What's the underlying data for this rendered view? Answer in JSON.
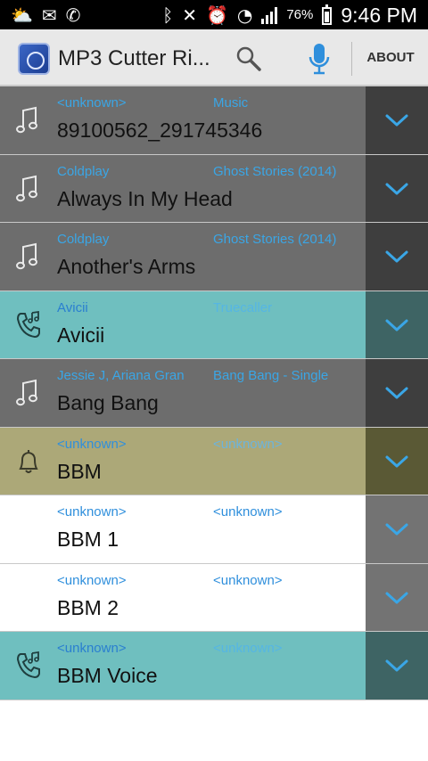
{
  "status_bar": {
    "left_icons": [
      "weather-icon",
      "message-icon",
      "missed-call-icon"
    ],
    "right_icons": [
      "bluetooth-icon",
      "vibrate-icon",
      "alarm-icon",
      "wifi-icon",
      "signal-icon"
    ],
    "battery_percent_text": "76%",
    "battery_level": 0.76,
    "time": "9:46 PM"
  },
  "app_bar": {
    "title": "MP3 Cutter Ri...",
    "about_label": "ABOUT",
    "accent_color": "#2f8fdc"
  },
  "rows": [
    {
      "type": "music",
      "artist": "<unknown>",
      "album": "Music",
      "title": "89100562_291745346",
      "bg": "#6d6d6d",
      "expand_bg": "#3e3e3e",
      "artist_color": "#3aa6e6",
      "album_color": "#3aa6e6",
      "title_color": "#111111"
    },
    {
      "type": "music",
      "artist": "Coldplay",
      "album": "Ghost Stories (2014)",
      "title": "Always In My Head",
      "bg": "#6d6d6d",
      "expand_bg": "#3e3e3e",
      "artist_color": "#3aa6e6",
      "album_color": "#3aa6e6",
      "title_color": "#111111"
    },
    {
      "type": "music",
      "artist": "Coldplay",
      "album": "Ghost Stories (2014)",
      "title": "Another's Arms",
      "bg": "#6d6d6d",
      "expand_bg": "#3e3e3e",
      "artist_color": "#3aa6e6",
      "album_color": "#3aa6e6",
      "title_color": "#111111"
    },
    {
      "type": "ringtone",
      "artist": "Avicii",
      "album": "Truecaller",
      "title": "Avicii",
      "bg": "#6fbfbf",
      "expand_bg": "#3e6464",
      "artist_color": "#2a7fd0",
      "album_color": "#55b6e4",
      "title_color": "#111111"
    },
    {
      "type": "music",
      "artist": "Jessie J, Ariana Gran",
      "album": "Bang Bang - Single",
      "title": "Bang Bang",
      "bg": "#6d6d6d",
      "expand_bg": "#3e3e3e",
      "artist_color": "#3aa6e6",
      "album_color": "#3aa6e6",
      "title_color": "#111111"
    },
    {
      "type": "notification",
      "artist": "<unknown>",
      "album": "<unknown>",
      "title": "BBM",
      "bg": "#aca878",
      "expand_bg": "#5a5935",
      "artist_color": "#2f8fdc",
      "album_color": "#6db4dc",
      "title_color": "#111111"
    },
    {
      "type": "none",
      "artist": "<unknown>",
      "album": "<unknown>",
      "title": "BBM 1",
      "bg": "#ffffff",
      "expand_bg": "#737373",
      "artist_color": "#2f8fdc",
      "album_color": "#2f8fdc",
      "title_color": "#111111"
    },
    {
      "type": "none",
      "artist": "<unknown>",
      "album": "<unknown>",
      "title": "BBM 2",
      "bg": "#ffffff",
      "expand_bg": "#737373",
      "artist_color": "#2f8fdc",
      "album_color": "#2f8fdc",
      "title_color": "#111111"
    },
    {
      "type": "ringtone",
      "artist": "<unknown>",
      "album": "<unknown>",
      "title": "BBM Voice",
      "bg": "#6fbfbf",
      "expand_bg": "#3e6464",
      "artist_color": "#2a7fd0",
      "album_color": "#55b6e4",
      "title_color": "#111111"
    }
  ]
}
